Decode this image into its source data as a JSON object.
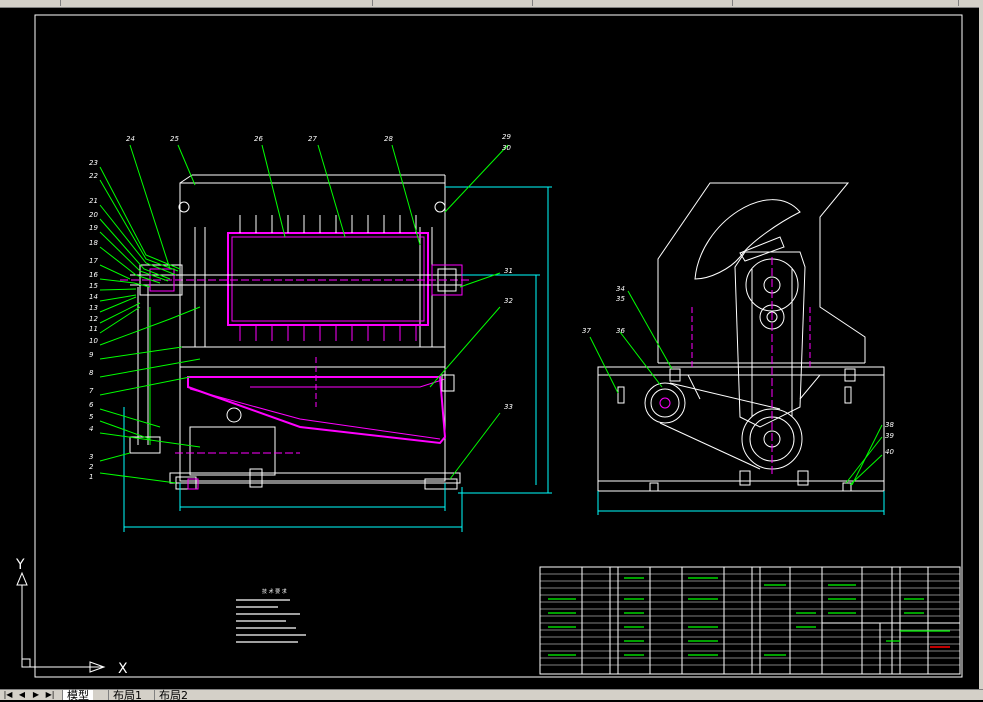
{
  "tabs": [
    {
      "label": "模型",
      "active": true
    },
    {
      "label": "布局1",
      "active": false
    },
    {
      "label": "布局2",
      "active": false
    }
  ],
  "nav_icons": [
    "first-tab-icon",
    "prev-tab-icon",
    "next-tab-icon",
    "last-tab-icon"
  ],
  "ucs": {
    "x_label": "X",
    "y_label": "Y"
  },
  "colors": {
    "background": "#000000",
    "outline": "#ffffff",
    "leader": "#00ff00",
    "part": "#ff00ff",
    "dimension": "#00ffff"
  },
  "front_view_callouts": [
    "1",
    "2",
    "3",
    "4",
    "5",
    "6",
    "7",
    "8",
    "9",
    "10",
    "11",
    "12",
    "13",
    "14",
    "15",
    "16",
    "17",
    "18",
    "19",
    "20",
    "21",
    "22",
    "23",
    "24",
    "25",
    "26",
    "27",
    "28",
    "29",
    "30",
    "31",
    "32",
    "33"
  ],
  "side_view_callouts": [
    "34",
    "35",
    "36",
    "37",
    "38",
    "39",
    "40"
  ],
  "tech_requirements_title": "技 术 要 求"
}
